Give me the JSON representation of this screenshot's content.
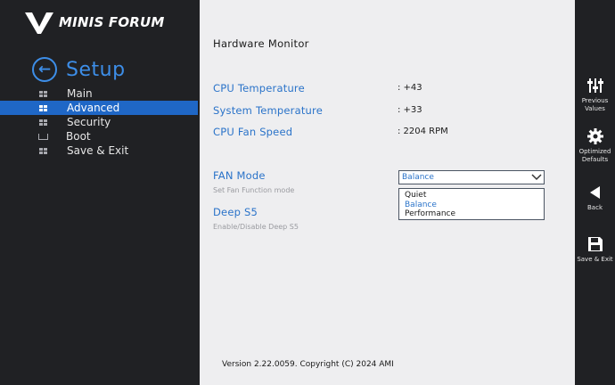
{
  "brand": {
    "logo_text": "MINIS FORUM"
  },
  "sidebar": {
    "title": "Setup",
    "items": [
      {
        "label": "Main",
        "icon": "grid-icon"
      },
      {
        "label": "Advanced",
        "icon": "grid-icon",
        "active": true
      },
      {
        "label": "Security",
        "icon": "grid-icon"
      },
      {
        "label": "Boot",
        "icon": "boot-icon"
      },
      {
        "label": "Save & Exit",
        "icon": "grid-icon"
      }
    ]
  },
  "main": {
    "section_title": "Hardware Monitor",
    "monitor": [
      {
        "label": "CPU Temperature",
        "value": ": +43"
      },
      {
        "label": "System Temperature",
        "value": ": +33"
      },
      {
        "label": "CPU Fan Speed",
        "value": ": 2204 RPM"
      }
    ],
    "fan_mode": {
      "label": "FAN Mode",
      "help": "Set Fan Function mode",
      "selected": "Balance",
      "options": [
        "Quiet",
        "Balance",
        "Performance"
      ]
    },
    "deep_s5": {
      "label": "Deep S5",
      "help": "Enable/Disable Deep S5"
    }
  },
  "footer": {
    "version": "Version 2.22.0059. Copyright (C) 2024 AMI"
  },
  "right_bar": {
    "previous_values": "Previous Values",
    "optimized_defaults": "Optimized Defaults",
    "back": "Back",
    "save_exit": "Save & Exit"
  },
  "colors": {
    "accent": "#2a73c9",
    "active_nav": "#1f67c6",
    "panel_dark": "#202124",
    "content_bg": "#eeeef0"
  }
}
